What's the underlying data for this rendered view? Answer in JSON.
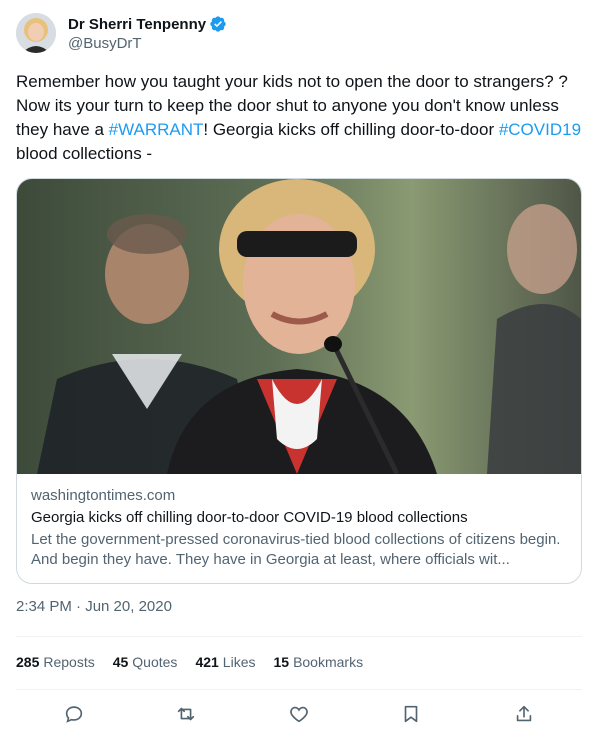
{
  "author": {
    "display_name": "Dr Sherri Tenpenny",
    "handle": "@BusyDrT",
    "verified": true
  },
  "tweet": {
    "line1": "Remember how you taught your kids not to open the door to strangers? ? Now its your turn to keep the door shut to anyone you don't know unless they have a ",
    "hashtag1": "#WARRANT",
    "line2": "! Georgia kicks off chilling door-to-door ",
    "hashtag2": "#COVID19",
    "line3": " blood collections -"
  },
  "card": {
    "domain": "washingtontimes.com",
    "title": "Georgia kicks off chilling door-to-door COVID-19 blood collections",
    "description": "Let the government-pressed coronavirus-tied blood collections of citizens begin. And begin they have. They have in Georgia at least, where officials wit..."
  },
  "timestamp": "2:34 PM · Jun 20, 2020",
  "stats": {
    "reposts_count": "285",
    "reposts_label": "Reposts",
    "quotes_count": "45",
    "quotes_label": "Quotes",
    "likes_count": "421",
    "likes_label": "Likes",
    "bookmarks_count": "15",
    "bookmarks_label": "Bookmarks"
  },
  "actions": [
    "reply-icon",
    "repost-icon",
    "like-icon",
    "bookmark-icon",
    "share-icon"
  ],
  "colors": {
    "link": "#1d9bf0",
    "text": "#0f1419",
    "secondary": "#536471",
    "verified": "#1d9bf0"
  }
}
